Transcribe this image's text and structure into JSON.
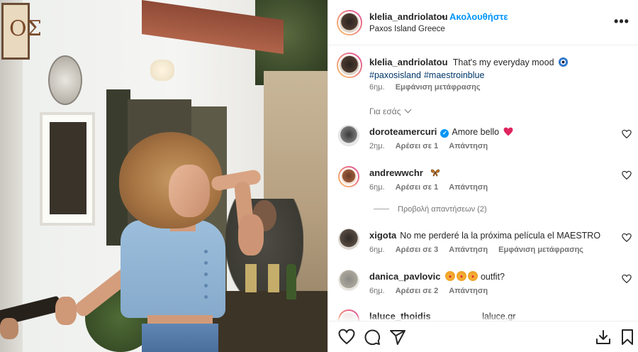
{
  "post": {
    "author": "klelia_andriolatou",
    "separator": "•",
    "follow_label": "Ακολουθήστε",
    "location": "Paxos Island Greece",
    "more_label": "•••",
    "photo_sign_text": "ΟΣ"
  },
  "caption": {
    "username": "klelia_andriolatou",
    "text": "That's my everyday mood",
    "emoji_icon": "nazar-amulet-icon",
    "hashtags": [
      "#paxosisland",
      "#maestroinblue"
    ],
    "time": "6ημ.",
    "translate_label": "Εμφάνιση μετάφρασης"
  },
  "for_you_label": "Για εσάς",
  "comments": [
    {
      "username": "doroteamercuri",
      "verified": true,
      "text": "Amore bello",
      "emoji": "beating-heart-icon",
      "time": "2ημ.",
      "likes": "Αρέσει σε 1",
      "reply": "Απάντηση"
    },
    {
      "username": "andrewwchr",
      "text": "",
      "emoji": "butterfly-icon",
      "time": "6ημ.",
      "likes": "Αρέσει σε 1",
      "reply": "Απάντηση"
    },
    {
      "username": "xigota",
      "text": "No me perderé la la próxima película el MAESTRO",
      "time": "6ημ.",
      "likes": "Αρέσει σε 3",
      "reply": "Απάντηση",
      "translate": "Εμφάνιση μετάφρασης"
    },
    {
      "username": "danica_pavlovic",
      "text": "outfit?",
      "emoji": "star-struck-icon",
      "time": "6ημ.",
      "likes": "Αρέσει σε 2",
      "reply": "Απάντηση"
    },
    {
      "username": "laluce_thoidis",
      "text": "laluce.gr"
    }
  ],
  "view_replies_label": "Προβολή απαντήσεων (2)",
  "actions": {
    "like": "heart-icon",
    "comment": "comment-icon",
    "share": "send-icon",
    "download": "download-icon",
    "save": "bookmark-icon"
  },
  "colors": {
    "link_blue": "#0095f6",
    "hashtag_blue": "#00376b",
    "muted": "#737373",
    "text": "#262626"
  }
}
